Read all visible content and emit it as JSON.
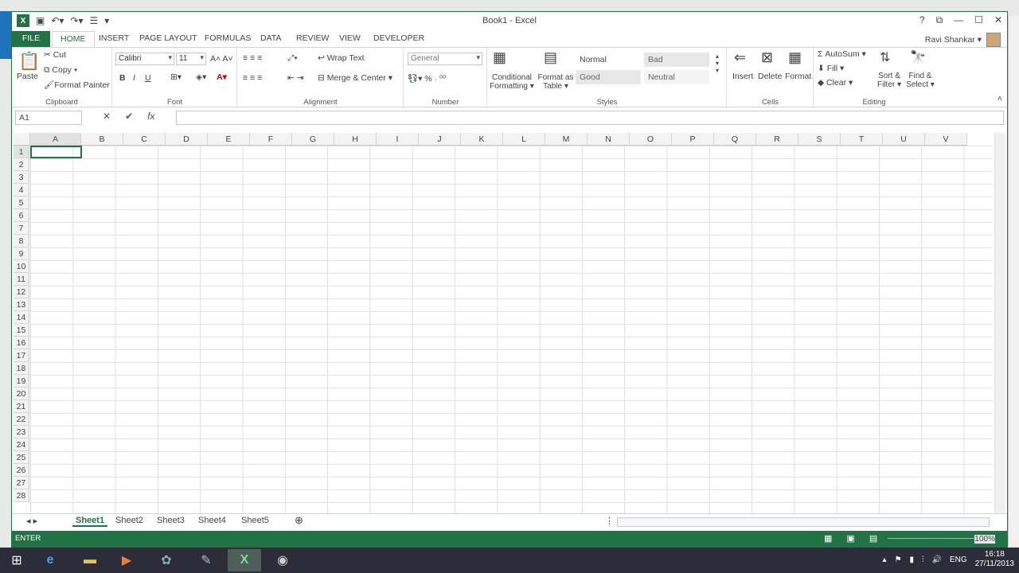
{
  "window": {
    "title": "Book1 - Excel"
  },
  "user": {
    "name": "Ravi Shankar ▾"
  },
  "tabs": [
    "FILE",
    "HOME",
    "INSERT",
    "PAGE LAYOUT",
    "FORMULAS",
    "DATA",
    "REVIEW",
    "VIEW",
    "DEVELOPER"
  ],
  "ribbon": {
    "clipboard": {
      "paste": "Paste",
      "cut": "Cut",
      "copy": "Copy ▾",
      "format_painter": "Format Painter",
      "label": "Clipboard"
    },
    "font": {
      "name": "Calibri",
      "size": "11",
      "bold": "B",
      "italic": "I",
      "underline": "U",
      "label": "Font"
    },
    "alignment": {
      "wrap": "Wrap Text",
      "merge": "Merge & Center ▾",
      "label": "Alignment"
    },
    "number": {
      "format": "General",
      "label": "Number"
    },
    "styles": {
      "conditional": "Conditional Formatting ▾",
      "format_as_table": "Format as Table ▾",
      "normal": "Normal",
      "bad": "Bad",
      "good": "Good",
      "neutral": "Neutral",
      "label": "Styles"
    },
    "cells": {
      "insert": "Insert",
      "delete": "Delete",
      "format": "Format",
      "label": "Cells"
    },
    "editing": {
      "autosum": "AutoSum ▾",
      "fill": "Fill ▾",
      "clear": "Clear ▾",
      "sort": "Sort & Filter ▾",
      "find": "Find & Select ▾",
      "label": "Editing"
    }
  },
  "formula_bar": {
    "name_box": "A1",
    "fx": "fx",
    "value": ""
  },
  "columns": [
    "A",
    "B",
    "C",
    "D",
    "E",
    "F",
    "G",
    "H",
    "I",
    "J",
    "K",
    "L",
    "M",
    "N",
    "O",
    "P",
    "Q",
    "R",
    "S",
    "T",
    "U",
    "V"
  ],
  "rows": [
    "1",
    "2",
    "3",
    "4",
    "5",
    "6",
    "7",
    "8",
    "9",
    "10",
    "11",
    "12",
    "13",
    "14",
    "15",
    "16",
    "17",
    "18",
    "19",
    "20",
    "21",
    "22",
    "23",
    "24",
    "25",
    "26",
    "27",
    "28"
  ],
  "sheets": [
    "Sheet1",
    "Sheet2",
    "Sheet3",
    "Sheet4",
    "Sheet5"
  ],
  "status": {
    "mode": "ENTER",
    "zoom": "100%"
  },
  "taskbar": {
    "lang": "ENG",
    "time": "16:18",
    "date": "27/11/2013"
  }
}
